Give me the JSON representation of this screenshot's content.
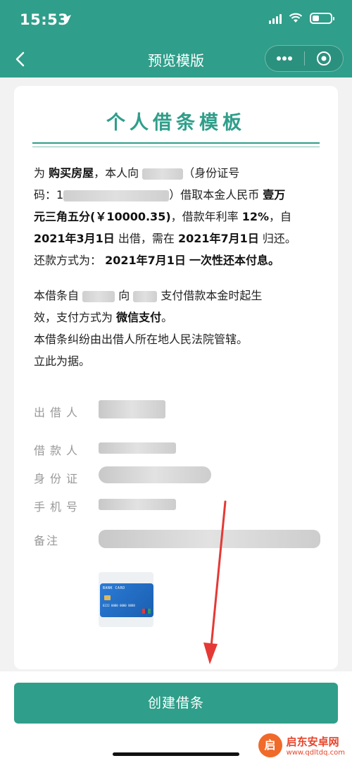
{
  "status_bar": {
    "time": "15:53"
  },
  "nav": {
    "title": "预览模版"
  },
  "document": {
    "title": "个人借条模板",
    "p1": {
      "w1": "为",
      "purpose": "购买房屋",
      "w2": "，本人向",
      "w3": "（身份证号",
      "w4": "码：1",
      "w5": "）借取本金人民币",
      "amount_words": "壹万",
      "amount_words2": "元三角五分(￥10000.35)",
      "w6": "，借款年利率",
      "rate": "12%",
      "w7": "，自",
      "start_date": "2021年3月1日",
      "w8": "出借，需在",
      "due_date": "2021年7月1日",
      "w9": "归还。",
      "w10": "还款方式为：",
      "repay_date": "2021年7月1日",
      "repay_method": "一次性还本付息。"
    },
    "p2": {
      "w1": "本借条自",
      "w2": "向",
      "w3": "支付借款本金时起生",
      "w4": "效，支付方式为",
      "pay_method": "微信支付",
      "w5": "。",
      "line3": "本借条纠纷由出借人所在地人民法院管辖。",
      "line4": "立此为据。"
    },
    "fields": {
      "lender": "出借人",
      "borrower": "借款人",
      "id_card": "身份证",
      "phone": "手机号",
      "note": "备注"
    },
    "bank_card": {
      "title": "BANK CARD",
      "number": "6222 0000 0000 8888"
    }
  },
  "footer": {
    "create_label": "创建借条"
  },
  "watermark": {
    "name": "启东安卓网",
    "url": "www.qdltdq.com"
  },
  "colors": {
    "brand": "#2f9e8a",
    "arrow": "#e53935"
  }
}
